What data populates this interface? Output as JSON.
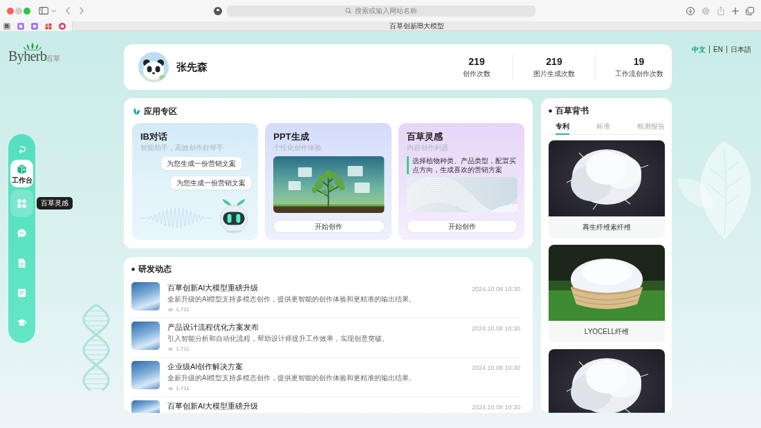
{
  "browser": {
    "favorites": [
      {
        "kind": "letter",
        "label": "B",
        "color": "#b3b3b3"
      },
      {
        "kind": "tile",
        "color": "#b27cf0"
      },
      {
        "kind": "tile",
        "color": "#9d7cf0"
      },
      {
        "kind": "shapes",
        "color": "#e0483e"
      },
      {
        "kind": "ring",
        "color": "#e2345a"
      }
    ],
    "address_placeholder": "搜索或输入网站名称",
    "tab_title": "百草创新IB大模型"
  },
  "logo": {
    "wordmark": "Byherb",
    "suffix": "百草"
  },
  "sidebar": {
    "items": [
      {
        "label": "工作台",
        "selected": true,
        "hovered": false
      },
      {
        "selected": false,
        "hovered": true,
        "tooltip": "百草灵感"
      },
      {
        "selected": false,
        "hovered": false
      },
      {
        "selected": false,
        "hovered": false
      },
      {
        "selected": false,
        "hovered": false
      },
      {
        "selected": false,
        "hovered": false
      }
    ]
  },
  "profile": {
    "name": "张先森",
    "stats": [
      {
        "value": "219",
        "label": "创作次数"
      },
      {
        "value": "219",
        "label": "图片生成次数"
      },
      {
        "value": "19",
        "label": "工作流创作次数"
      }
    ]
  },
  "languages": [
    {
      "label": "中文",
      "selected": true
    },
    {
      "label": "EN",
      "selected": false
    },
    {
      "label": "日本語",
      "selected": false
    }
  ],
  "apps_section": {
    "title": "应用专区",
    "apps": [
      {
        "kind": "chat",
        "title": "IB对话",
        "subtitle": "智能助手，高效创作好帮手",
        "bubbles": [
          "为您生成一份营销文案",
          "为您生成一份营销文案"
        ]
      },
      {
        "kind": "image",
        "title": "PPT生成",
        "subtitle": "个性化创作体验",
        "button": "开始创作"
      },
      {
        "kind": "quote",
        "title": "百草灵感",
        "subtitle": "内容创作利器",
        "quote": "选择植物种类、产品类型，配置买点方向，生成喜欢的营销方案",
        "button": "开始创作"
      }
    ]
  },
  "news": {
    "title": "研发动态",
    "items": [
      {
        "title": "百草创新AI大模型重磅升级",
        "summary": "全新升级的AI模型支持多模态创作，提供更智能的创作体验和更精准的输出结果。",
        "views": "1,711",
        "date": "2024.10.08 10:30"
      },
      {
        "title": "产品设计流程优化方案发布",
        "summary": "引入智能分析和自动化流程，帮助设计师提升工作效率，实现创意突破。",
        "views": "1,711",
        "date": "2024.10.08 10:30"
      },
      {
        "title": "企业级AI创作解决方案",
        "summary": "全新升级的AI模型支持多模态创作，提供更智能的创作体验和更精准的输出结果。",
        "views": "1,711",
        "date": "2024.10.08 10:30"
      },
      {
        "title": "百草创新AI大模型重磅升级",
        "date": "2024.10.08 10:30"
      }
    ]
  },
  "endorsement": {
    "title": "百草背书",
    "tabs": [
      {
        "label": "专利",
        "selected": true
      },
      {
        "label": "标准",
        "selected": false
      },
      {
        "label": "检测报告",
        "selected": false
      }
    ],
    "products": [
      {
        "kind": "tuft",
        "caption": "再生纤维素纤维"
      },
      {
        "kind": "basket",
        "caption": "LYOCELL纤维"
      },
      {
        "kind": "tuft"
      }
    ]
  }
}
